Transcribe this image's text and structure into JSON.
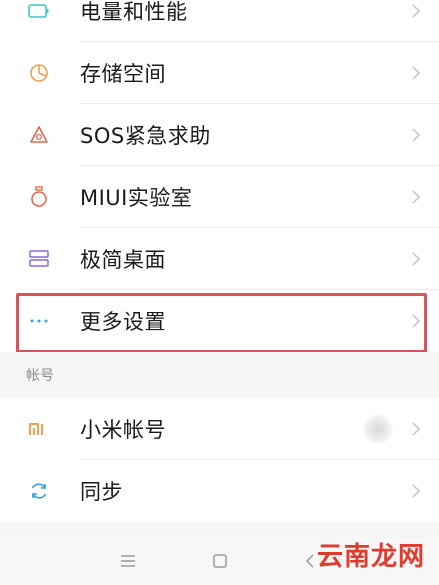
{
  "settings_group_1": {
    "items": [
      {
        "label": "电量和性能",
        "icon": "battery-icon"
      },
      {
        "label": "存储空间",
        "icon": "storage-pie-icon"
      },
      {
        "label": "SOS紧急求助",
        "icon": "sos-alert-icon"
      },
      {
        "label": "MIUI实验室",
        "icon": "lab-flask-icon"
      },
      {
        "label": "极简桌面",
        "icon": "simple-desktop-icon"
      },
      {
        "label": "更多设置",
        "icon": "more-dots-icon"
      }
    ]
  },
  "account_section": {
    "header": "帐号",
    "items": [
      {
        "label": "小米帐号",
        "icon": "mi-logo-icon"
      },
      {
        "label": "同步",
        "icon": "sync-icon"
      }
    ]
  },
  "watermark": {
    "text": "云南龙网"
  },
  "colors": {
    "highlight_border": "#d9535b",
    "battery_icon": "#3cc9c0",
    "storage_icon": "#f0a24e",
    "sos_icon": "#e7684f",
    "lab_icon": "#e7684f",
    "desktop_icon": "#8a6ad8",
    "more_icon": "#3aa3e3",
    "mi_icon": "#f0a24e",
    "sync_icon": "#3a9ee3"
  }
}
